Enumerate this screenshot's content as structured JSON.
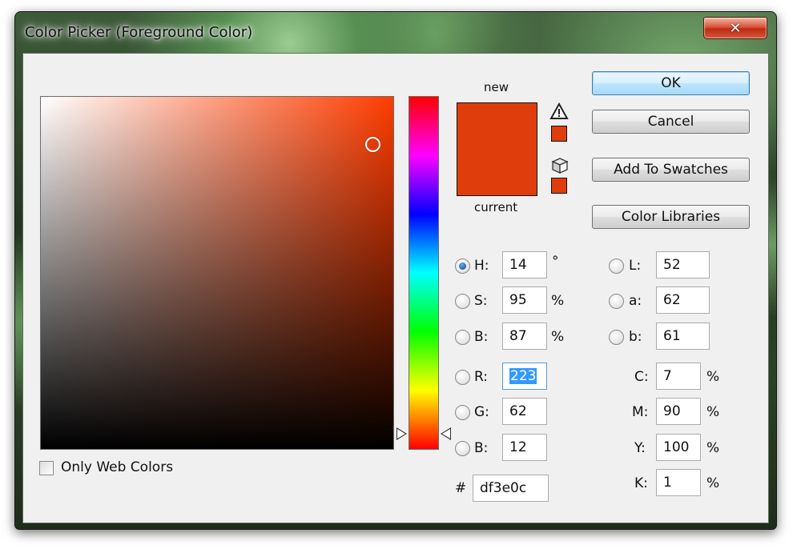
{
  "window": {
    "title": "Color Picker (Foreground Color)",
    "close_glyph": "✕"
  },
  "colors": {
    "current_color": "#df3e0c",
    "accent": "#3399ff"
  },
  "picker": {
    "only_web_colors_label": "Only Web Colors",
    "only_web_colors_checked": false
  },
  "preview": {
    "new_label": "new",
    "current_label": "current",
    "gamut_warning_icon": "warning-triangle-icon",
    "web_safe_icon": "cube-icon"
  },
  "buttons": {
    "ok": "OK",
    "cancel": "Cancel",
    "add_to_swatches": "Add To Swatches",
    "color_libraries": "Color Libraries"
  },
  "hsb": {
    "h": {
      "label": "H:",
      "value": "14",
      "unit": "°",
      "selected": true
    },
    "s": {
      "label": "S:",
      "value": "95",
      "unit": "%",
      "selected": false
    },
    "b": {
      "label": "B:",
      "value": "87",
      "unit": "%",
      "selected": false
    }
  },
  "rgb": {
    "r": {
      "label": "R:",
      "value": "223",
      "selected": false
    },
    "g": {
      "label": "G:",
      "value": "62",
      "selected": false
    },
    "b": {
      "label": "B:",
      "value": "12",
      "selected": false
    }
  },
  "lab": {
    "l": {
      "label": "L:",
      "value": "52",
      "selected": false
    },
    "a": {
      "label": "a:",
      "value": "62",
      "selected": false
    },
    "b": {
      "label": "b:",
      "value": "61",
      "selected": false
    }
  },
  "cmyk": {
    "c": {
      "label": "C:",
      "value": "7",
      "unit": "%"
    },
    "m": {
      "label": "M:",
      "value": "90",
      "unit": "%"
    },
    "y": {
      "label": "Y:",
      "value": "100",
      "unit": "%"
    },
    "k": {
      "label": "K:",
      "value": "1",
      "unit": "%"
    }
  },
  "hex": {
    "label": "#",
    "value": "df3e0c"
  }
}
